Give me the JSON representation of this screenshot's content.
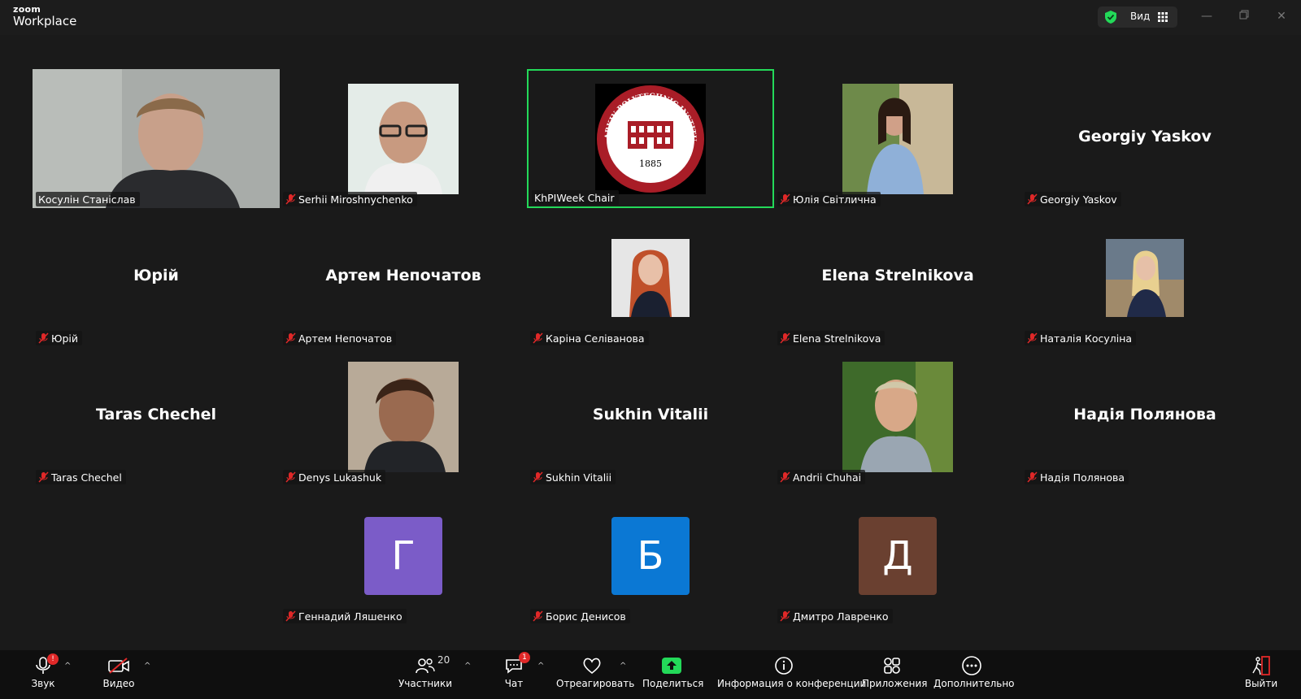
{
  "app": {
    "logo_small": "zoom",
    "logo_big": "Workplace",
    "view_label": "Вид"
  },
  "participants": [
    {
      "name": "Косулін Станіслав",
      "display": "",
      "muted": false,
      "kind": "video"
    },
    {
      "name": "Serhii Miroshnychenko",
      "display": "",
      "muted": true,
      "kind": "photo"
    },
    {
      "name": "KhPIWeek Chair",
      "display": "",
      "muted": false,
      "kind": "seal",
      "seal_top": "KHARKIV POLYTECHNIC INSTITUTE",
      "seal_year": "1885",
      "seal_bottom": "NTU"
    },
    {
      "name": "Юлія Світлична",
      "display": "",
      "muted": true,
      "kind": "photo"
    },
    {
      "name": "Georgiy Yaskov",
      "display": "Georgiy Yaskov",
      "muted": true,
      "kind": "text"
    },
    {
      "name": "Юрій",
      "display": "Юрій",
      "muted": true,
      "kind": "text"
    },
    {
      "name": "Артем Непочатов",
      "display": "Артем Непочатов",
      "muted": true,
      "kind": "text"
    },
    {
      "name": "Каріна Селіванова",
      "display": "",
      "muted": true,
      "kind": "photo-small"
    },
    {
      "name": "Elena Strelnikova",
      "display": "Elena Strelnikova",
      "muted": true,
      "kind": "text"
    },
    {
      "name": "Наталія Косуліна",
      "display": "",
      "muted": true,
      "kind": "photo-small"
    },
    {
      "name": "Taras Chechel",
      "display": "Taras Chechel",
      "muted": true,
      "kind": "text"
    },
    {
      "name": "Denys Lukashuk",
      "display": "",
      "muted": true,
      "kind": "photo"
    },
    {
      "name": "Sukhin Vitalii",
      "display": "Sukhin Vitalii",
      "muted": true,
      "kind": "text"
    },
    {
      "name": "Andrii Chuhai",
      "display": "",
      "muted": true,
      "kind": "photo"
    },
    {
      "name": "Надія Полянова",
      "display": "Надія Полянова",
      "muted": true,
      "kind": "text"
    },
    {
      "name": "Геннадий Ляшенко",
      "display": "Г",
      "muted": true,
      "kind": "letter",
      "color": "#7b5cc8"
    },
    {
      "name": "Борис Денисов",
      "display": "Б",
      "muted": true,
      "kind": "letter",
      "color": "#0b78d4"
    },
    {
      "name": "Дмитро Лавренко",
      "display": "Д",
      "muted": true,
      "kind": "letter",
      "color": "#6a4030"
    }
  ],
  "toolbar": {
    "audio": "Звук",
    "video": "Видео",
    "participants": "Участники",
    "participants_count": "20",
    "chat": "Чат",
    "chat_badge": "1",
    "audio_badge": "!",
    "react": "Отреагировать",
    "share": "Поделиться",
    "info": "Информация о конференции",
    "apps": "Приложения",
    "more": "Дополнительно",
    "leave": "Выйти"
  },
  "colors": {
    "active_speaker": "#23d959",
    "share_green": "#23d959",
    "mute_red": "#e02828"
  }
}
